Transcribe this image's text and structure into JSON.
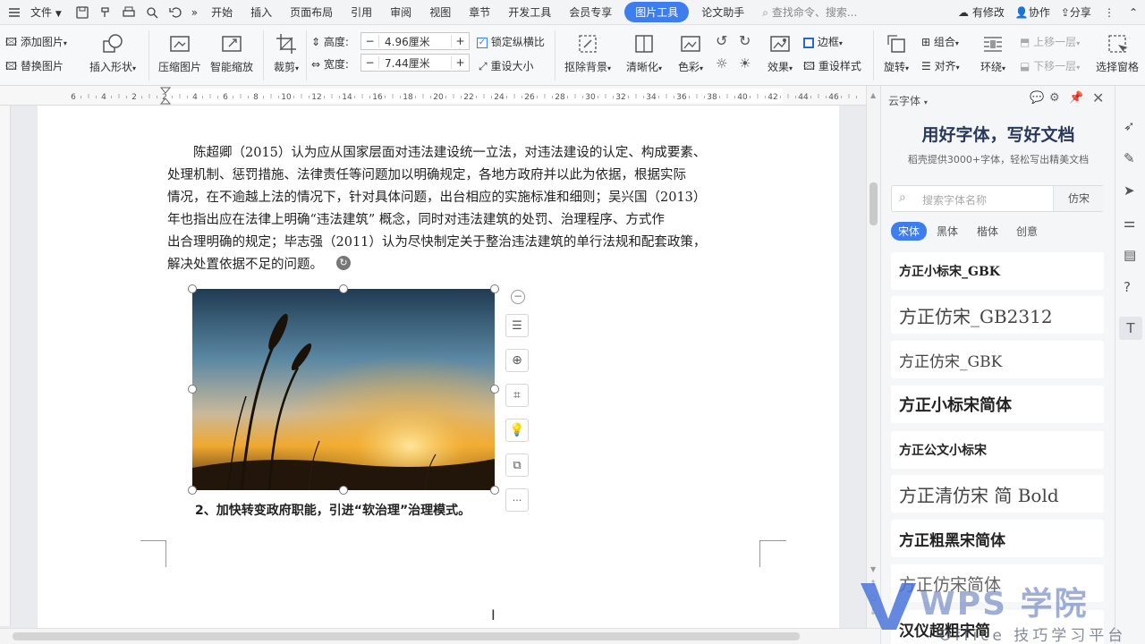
{
  "menubar": {
    "file_label": "文件",
    "tabs": [
      "开始",
      "插入",
      "页面布局",
      "引用",
      "审阅",
      "视图",
      "章节",
      "开发工具",
      "会员专享"
    ],
    "active_tab": "图片工具",
    "tab_after": "论文助手",
    "search_placeholder": "查找命令、搜索...",
    "has_changes": "有修改",
    "collaborate": "协作",
    "share": "分享"
  },
  "ribbon": {
    "add_picture": "添加图片",
    "replace_picture": "替换图片",
    "insert_shape": "插入形状",
    "compress_picture": "压缩图片",
    "smart_scale": "智能缩放",
    "crop": "裁剪",
    "height_label": "高度:",
    "height_value": "4.96厘米",
    "width_label": "宽度:",
    "width_value": "7.44厘米",
    "lock_ratio": "锁定纵横比",
    "reset_size": "重设大小",
    "remove_bg": "抠除背景",
    "sharpen": "清晰化",
    "color": "色彩",
    "effects": "效果",
    "border": "边框",
    "reset_style": "重设样式",
    "rotate": "旋转",
    "group": "组合",
    "align": "对齐",
    "wrap": "环绕",
    "bring_forward": "上移一层",
    "send_backward": "下移一层",
    "select_pane": "选择窗格"
  },
  "ruler": {
    "ticks": [
      "6",
      "4",
      "2",
      "2",
      "4",
      "6",
      "8",
      "10",
      "12",
      "14",
      "16",
      "18",
      "20",
      "22",
      "24",
      "26",
      "28",
      "30",
      "32",
      "34",
      "36",
      "38",
      "40",
      "42",
      "44",
      "46"
    ]
  },
  "document": {
    "paragraph_lines": [
      "陈超卿（2015）认为应从国家层面对违法建设统一立法，对违法建设的认定、构成要素、",
      "处理机制、惩罚措施、法律责任等问题加以明确规定，各地方政府并以此为依据，根据实际",
      "情况，在不逾越上法的情况下，针对具体问题，出台相应的实施标准和细则；吴兴国（2013）",
      "年也指出应在法律上明确“违法建筑” 概念，同时对违法建筑的处罚、治理程序、方式作",
      "出合理明确的规定；毕志强（2011）认为尽快制定关于整治违法建筑的单行法规和配套政策，",
      "解决处置依据不足的问题。"
    ],
    "heading2": "2、加快转变政府职能，引进“软治理”治理模式。",
    "more_label": "···"
  },
  "panel": {
    "title_small": "云字体",
    "headline": "用好字体，写好文档",
    "subline": "稻壳提供3000+字体，轻松写出精美文档",
    "search_placeholder": "搜索字体名称",
    "search_preview": "仿宋",
    "categories": [
      "宋体",
      "黑体",
      "楷体",
      "创意"
    ],
    "fonts": [
      "方正小标宋_GBK",
      "方正仿宋_GB2312",
      "方正仿宋_GBK",
      "方正小标宋简体",
      "方正公文小标宋",
      "方正清仿宋 简 Bold",
      "方正粗黑宋简体",
      "方正仿宋简体",
      "汉仪超粗宋简"
    ]
  },
  "watermark": {
    "brand": "WPS 学院",
    "tagline": "Office 技巧学习平台"
  },
  "colors": {
    "accent": "#3d7dee",
    "brand_blue": "#2e66d8"
  }
}
